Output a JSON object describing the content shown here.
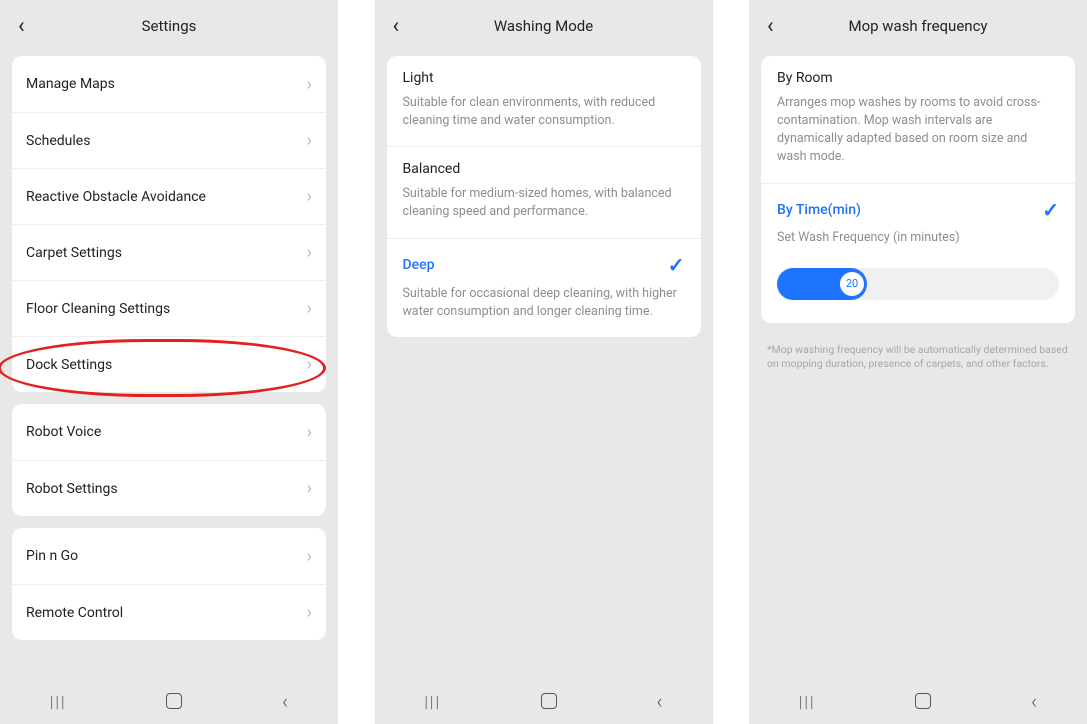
{
  "settings": {
    "title": "Settings",
    "group1": [
      {
        "label": "Manage Maps"
      },
      {
        "label": "Schedules"
      },
      {
        "label": "Reactive Obstacle Avoidance"
      },
      {
        "label": "Carpet Settings"
      },
      {
        "label": "Floor Cleaning Settings"
      },
      {
        "label": "Dock Settings"
      }
    ],
    "group2": [
      {
        "label": "Robot Voice"
      },
      {
        "label": "Robot Settings"
      }
    ],
    "group3": [
      {
        "label": "Pin n Go"
      },
      {
        "label": "Remote Control"
      }
    ]
  },
  "washing": {
    "title": "Washing Mode",
    "options": [
      {
        "title": "Light",
        "desc": "Suitable for clean environments, with reduced cleaning time and water consumption.",
        "selected": false
      },
      {
        "title": "Balanced",
        "desc": "Suitable for medium-sized homes, with balanced cleaning speed and performance.",
        "selected": false
      },
      {
        "title": "Deep",
        "desc": "Suitable for occasional deep cleaning, with higher water consumption and longer cleaning time.",
        "selected": true
      }
    ]
  },
  "freq": {
    "title": "Mop wash frequency",
    "byroom_title": "By Room",
    "byroom_desc": "Arranges mop washes by rooms to avoid cross-contamination. Mop wash intervals are dynamically adapted based on room size and wash mode.",
    "bytime_title": "By Time(min)",
    "bytime_sub": "Set Wash Frequency (in minutes)",
    "slider_value": "20",
    "footnote": "*Mop washing frequency will be automatically determined based on mopping duration, presence of carpets, and other factors."
  },
  "accent": "#1e73ff"
}
